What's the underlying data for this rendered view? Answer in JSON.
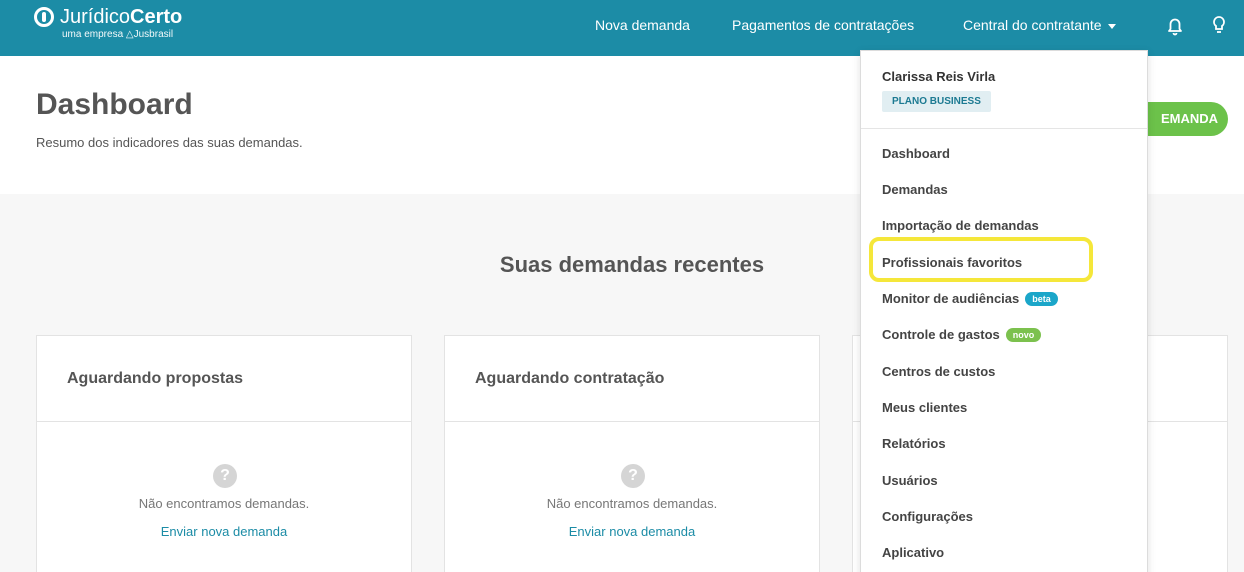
{
  "brand": {
    "name_light": "Jurídico",
    "name_bold": "Certo",
    "tagline": "uma empresa",
    "parent": "Jusbrasil"
  },
  "nav": {
    "new_demand": "Nova demanda",
    "payments": "Pagamentos de contratações",
    "central": "Central do contratante",
    "bell_icon": "bell-icon",
    "bulb_icon": "lightbulb-icon"
  },
  "header": {
    "title": "Dashboard",
    "subtitle": "Resumo dos indicadores das suas demandas.",
    "cta_partial": "EMANDA"
  },
  "recent": {
    "title": "Suas demandas recentes",
    "cards": [
      {
        "title": "Aguardando propostas",
        "empty": "Não encontramos demandas.",
        "link": "Enviar nova demanda"
      },
      {
        "title": "Aguardando contratação",
        "empty": "Não encontramos demandas.",
        "link": "Enviar nova demanda"
      }
    ]
  },
  "dropdown": {
    "user_name": "Clarissa Reis Virla",
    "plan": "PLANO BUSINESS",
    "items": [
      {
        "label": "Dashboard"
      },
      {
        "label": "Demandas"
      },
      {
        "label": "Importação de demandas"
      },
      {
        "label": "Profissionais favoritos",
        "highlighted": true
      },
      {
        "label": "Monitor de audiências",
        "badge": "beta",
        "badge_color": "#1ba6c9"
      },
      {
        "label": "Controle de gastos",
        "badge": "novo",
        "badge_color": "#7cc14e"
      },
      {
        "label": "Centros de custos"
      },
      {
        "label": "Meus clientes"
      },
      {
        "label": "Relatórios"
      },
      {
        "label": "Usuários"
      },
      {
        "label": "Configurações"
      },
      {
        "label": "Aplicativo"
      }
    ]
  },
  "colors": {
    "topbar": "#1c8ca6",
    "accent_green": "#6cc24a",
    "highlight": "#f5e73a"
  }
}
